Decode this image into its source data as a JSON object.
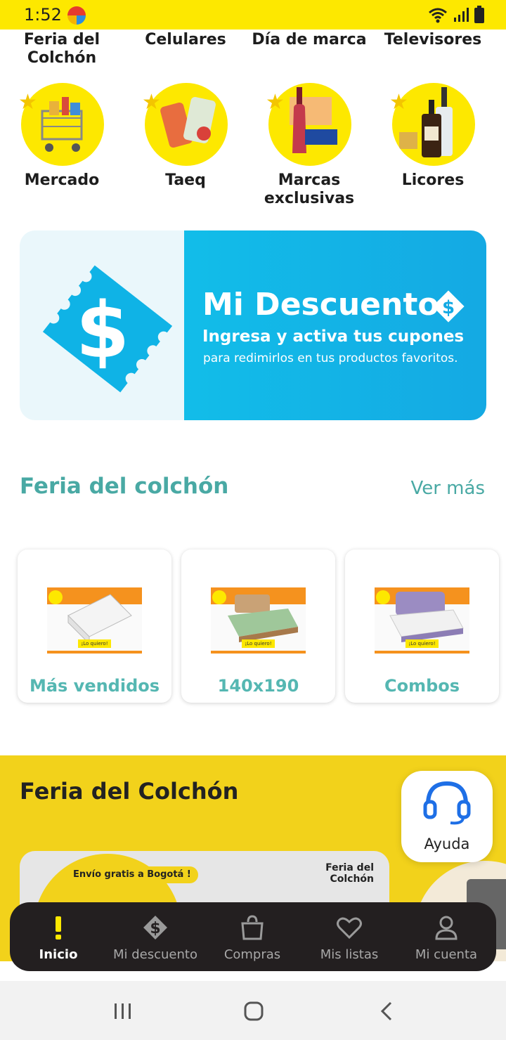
{
  "status_bar": {
    "time": "1:52"
  },
  "categories_top": [
    "Feria del Colchón",
    "Celulares",
    "Día de marca",
    "Televisores"
  ],
  "categories": [
    {
      "label": "Mercado",
      "icon": "shopping-cart-icon"
    },
    {
      "label": "Taeq",
      "icon": "health-products-icon"
    },
    {
      "label": "Marcas exclusivas",
      "icon": "exclusive-brands-icon"
    },
    {
      "label": "Licores",
      "icon": "liquor-bottles-icon"
    }
  ],
  "banner": {
    "title": "Mi Descuento",
    "subtitle": "Ingresa y activa tus cupones",
    "text": "para redimirlos en tus productos favoritos."
  },
  "section": {
    "title": "Feria del colchón",
    "see_more": "Ver más"
  },
  "cards": [
    {
      "label": "Más vendidos",
      "badge": "¡Lo quiero!"
    },
    {
      "label": "140x190",
      "badge": "¡Lo quiero!"
    },
    {
      "label": "Combos",
      "badge": "¡Lo quiero!"
    }
  ],
  "promo": {
    "title": "Feria del Colchón",
    "chip": "Envío gratis a Bogotá !",
    "logo_text": "Feria del Colchón"
  },
  "help": {
    "label": "Ayuda"
  },
  "bottom_nav": [
    {
      "label": "Inicio",
      "icon": "exclamation-icon",
      "active": true
    },
    {
      "label": "Mi descuento",
      "icon": "discount-tag-icon",
      "active": false
    },
    {
      "label": "Compras",
      "icon": "shopping-bag-icon",
      "active": false
    },
    {
      "label": "Mis listas",
      "icon": "heart-icon",
      "active": false
    },
    {
      "label": "Mi cuenta",
      "icon": "user-icon",
      "active": false
    }
  ],
  "colors": {
    "brand_yellow": "#fde800",
    "accent_teal": "#49a9a4",
    "banner_blue": "#12bde9",
    "nav_bg": "#231f20"
  }
}
